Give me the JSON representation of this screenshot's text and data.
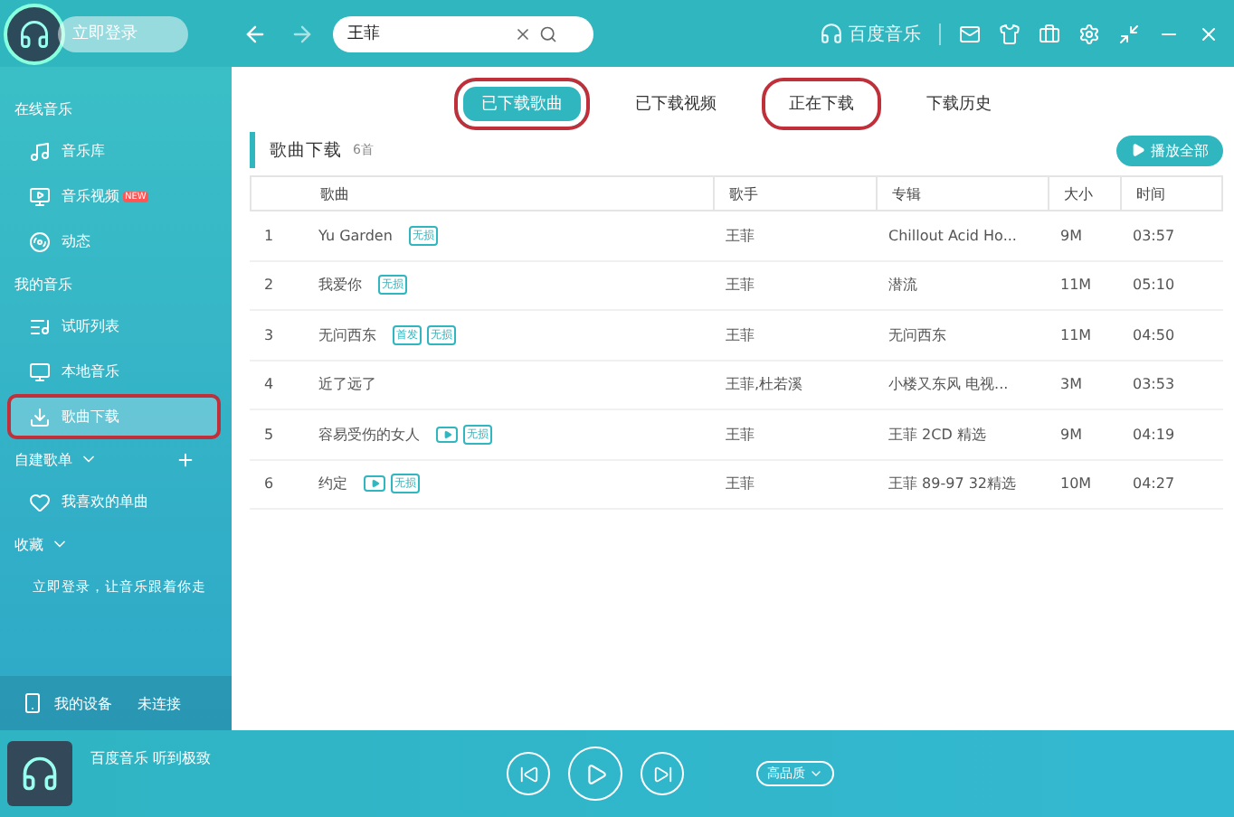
{
  "topbar": {
    "login": "立即登录",
    "search": {
      "value": "王菲"
    },
    "brand": "百度音乐"
  },
  "sidebar": {
    "sections": [
      {
        "title": "在线音乐",
        "items": [
          {
            "label": "音乐库",
            "selected": false,
            "highlighted": false
          },
          {
            "label": "音乐视频",
            "badge": "NEW",
            "selected": false,
            "highlighted": false
          },
          {
            "label": "动态",
            "selected": false,
            "highlighted": false
          }
        ]
      },
      {
        "title": "我的音乐",
        "items": [
          {
            "label": "试听列表",
            "selected": false,
            "highlighted": false
          },
          {
            "label": "本地音乐",
            "selected": false,
            "highlighted": false
          },
          {
            "label": "歌曲下载",
            "selected": true,
            "highlighted": true
          }
        ]
      },
      {
        "title": "自建歌单",
        "expandable": true,
        "addable": true,
        "items": [
          {
            "label": "我喜欢的单曲",
            "selected": false,
            "highlighted": false
          }
        ]
      },
      {
        "title": "收藏",
        "expandable": true
      }
    ],
    "login_hint": "立即登录，让音乐跟着你走",
    "device": {
      "label": "我的设备",
      "status": "未连接"
    }
  },
  "tabs": [
    {
      "label": "已下载歌曲",
      "selected": true,
      "highlighted": true
    },
    {
      "label": "已下载视频",
      "selected": false,
      "highlighted": false
    },
    {
      "label": "正在下载",
      "selected": false,
      "highlighted": true
    },
    {
      "label": "下载历史",
      "selected": false,
      "highlighted": false
    }
  ],
  "section": {
    "title": "歌曲下载",
    "count": "6首",
    "play_all": "播放全部"
  },
  "table": {
    "columns": [
      "歌曲",
      "歌手",
      "专辑",
      "大小",
      "时间"
    ],
    "rows": [
      {
        "index": "1",
        "song": "Yu Garden",
        "tags": [
          {
            "kind": "text",
            "label": "无损"
          }
        ],
        "singer": "王菲",
        "album": "Chillout  Acid Ho...",
        "size": "9M",
        "time": "03:57"
      },
      {
        "index": "2",
        "song": "我爱你",
        "tags": [
          {
            "kind": "text",
            "label": "无损"
          }
        ],
        "singer": "王菲",
        "album": "潜流",
        "size": "11M",
        "time": "05:10"
      },
      {
        "index": "3",
        "song": "无问西东",
        "tags": [
          {
            "kind": "text",
            "label": "首发"
          },
          {
            "kind": "text",
            "label": "无损"
          }
        ],
        "singer": "王菲",
        "album": "无问西东",
        "size": "11M",
        "time": "04:50"
      },
      {
        "index": "4",
        "song": "近了远了",
        "singer": "王菲,杜若溪",
        "album": "小楼又东风 电视...",
        "size": "3M",
        "time": "03:53"
      },
      {
        "index": "5",
        "song": "容易受伤的女人",
        "tags": [
          {
            "kind": "mv"
          },
          {
            "kind": "text",
            "label": "无损"
          }
        ],
        "singer": "王菲",
        "album": "王菲 2CD 精选",
        "size": "9M",
        "time": "04:19"
      },
      {
        "index": "6",
        "song": "约定",
        "tags": [
          {
            "kind": "mv"
          },
          {
            "kind": "text",
            "label": "无损"
          }
        ],
        "singer": "王菲",
        "album": "王菲 89-97 32精选",
        "size": "10M",
        "time": "04:27"
      }
    ]
  },
  "player": {
    "track": "百度音乐 听到极致",
    "quality": "高品质"
  }
}
